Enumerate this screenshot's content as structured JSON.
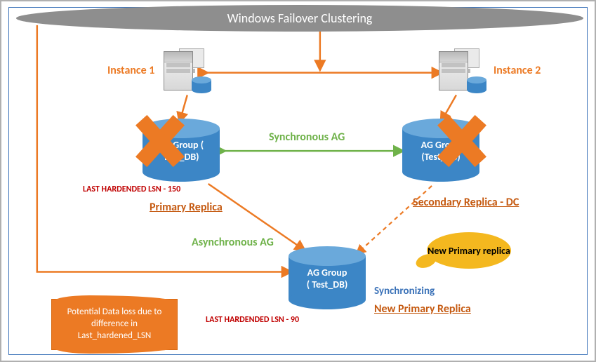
{
  "banner": {
    "title": "Windows Failover Clustering"
  },
  "instances": {
    "i1": "Instance 1",
    "i2": "Instance 2"
  },
  "db1": {
    "line1": "AG Group (",
    "line2": "Test_DB)"
  },
  "db2": {
    "line1": "AG Group",
    "line2": "(Test_DB)"
  },
  "db3": {
    "line1": "AG Group",
    "line2": "( Test_DB)"
  },
  "labels": {
    "syncAG": "Synchronous AG",
    "asyncAG": "Asynchronous AG",
    "primary": "Primary Replica",
    "secondaryDC": "Secondary Replica - DC",
    "synchronizing": "Synchronizing",
    "newPrimary": "New Primary Replica"
  },
  "lsn": {
    "left": "LAST HARDENDED LSN - 150",
    "bottom": "LAST HARDENDED LSN - 90"
  },
  "callout": {
    "text": "New Primary replica"
  },
  "ribbon": {
    "text": "Potential Data loss due to difference in Last_hardened_LSN"
  }
}
